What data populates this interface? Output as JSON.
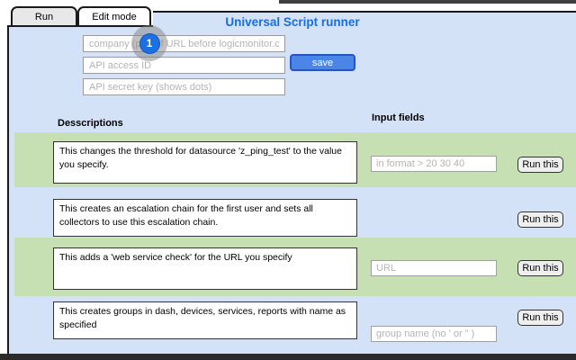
{
  "window": {
    "title": "Universal Script runner"
  },
  "tabs": {
    "run": "Run",
    "edit_mode": "Edit mode"
  },
  "credentials": {
    "company_placeholder": "company (part of URL before logicmonitor.com)",
    "access_id_placeholder": "API access ID",
    "secret_key_placeholder": "API secret key (shows dots)",
    "save_label": "save",
    "step_badge": "1"
  },
  "table": {
    "descriptions_header": "Desscriptions",
    "input_fields_header": "Input fields",
    "run_button_label": "Run this",
    "rows": [
      {
        "description": "This changes the threshold for datasource 'z_ping_test' to the value you specify.",
        "input_placeholder": "in format > 20 30 40"
      },
      {
        "description": "This creates an escalation chain for the first user and sets all collectors to use this escalation chain."
      },
      {
        "description": "This adds a 'web service check' for the URL you specify",
        "input_placeholder": "URL"
      },
      {
        "description": "This creates groups in dash, devices, services, reports with name as specified",
        "input_placeholder": "group name (no ' or \" )"
      }
    ]
  },
  "colors": {
    "panel_blue": "#d3e2f7",
    "row_green": "#c6e0b4",
    "title_blue": "#1a6ee0",
    "save_button_blue": "#4a86e8",
    "badge_blue": "#1e6fe4"
  }
}
